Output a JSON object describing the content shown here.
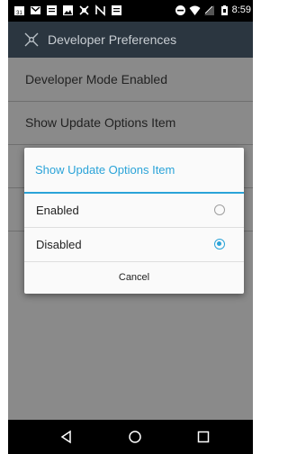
{
  "status_bar": {
    "time": "8:59",
    "icons": [
      "calendar-icon",
      "gmail-icon",
      "notes-icon",
      "image-icon",
      "puzzle-icon",
      "nfc-icon",
      "notes-icon",
      "dnd-icon",
      "wifi-icon",
      "signal-icon",
      "battery-icon"
    ]
  },
  "app_bar": {
    "title": "Developer Preferences",
    "icon": "developer-tools-icon",
    "background": "#2b3640"
  },
  "list": {
    "items": [
      {
        "label": "Developer Mode Enabled"
      },
      {
        "label": "Show Update Options Item"
      }
    ]
  },
  "dialog": {
    "title": "Show Update Options Item",
    "accent": "#2aa3d8",
    "options": [
      {
        "label": "Enabled",
        "checked": false
      },
      {
        "label": "Disabled",
        "checked": true
      }
    ],
    "cancel_label": "Cancel"
  },
  "nav_bar": {
    "icons": [
      "back-icon",
      "home-icon",
      "recents-icon"
    ]
  }
}
